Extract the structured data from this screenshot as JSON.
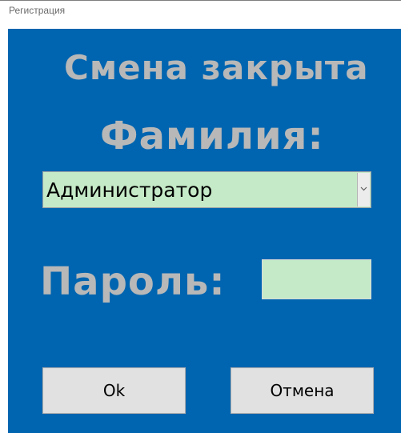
{
  "window": {
    "title": "Регистрация"
  },
  "form": {
    "shift_status": "Смена закрыта",
    "surname_label": "Фамилия:",
    "surname_select": {
      "selected": "Администратор",
      "arrow_icon": "chevron-down-icon"
    },
    "password_label": "Пароль:",
    "password_value": "",
    "ok_label": "Ok",
    "cancel_label": "Отмена"
  },
  "colors": {
    "panel_background": "#0065b0",
    "heading_text": "#b8b8b8",
    "field_background": "#c5eac7",
    "button_background": "#e1e1e1"
  }
}
